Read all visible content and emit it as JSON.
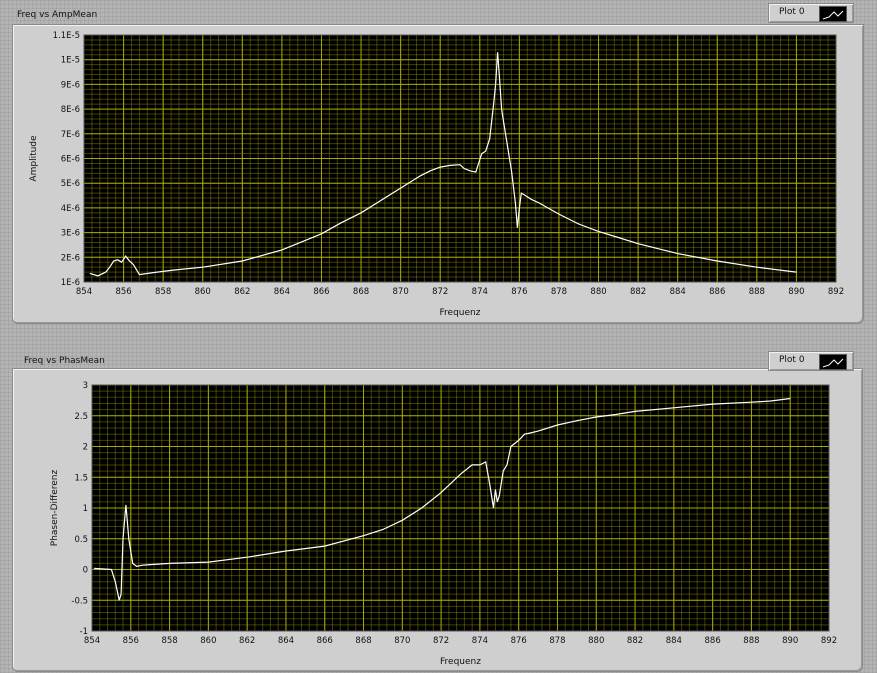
{
  "graphs": [
    {
      "title": "Freq vs AmpMean",
      "legend_label": "Plot 0"
    },
    {
      "title": "Freq vs PhasMean",
      "legend_label": "Plot 0"
    }
  ],
  "colors": {
    "plot_bg": "#000000",
    "grid": "#b4b400",
    "trace": "#ffffff"
  },
  "chart_data": [
    {
      "type": "line",
      "title": "Freq vs AmpMean",
      "xlabel": "Frequenz",
      "ylabel": "Amplitude",
      "xlim": [
        854,
        892
      ],
      "ylim": [
        1e-06,
        1.1e-05
      ],
      "x_ticks": [
        854,
        856,
        858,
        860,
        862,
        864,
        866,
        868,
        870,
        872,
        874,
        876,
        878,
        880,
        882,
        884,
        886,
        888,
        890,
        892
      ],
      "y_ticks": [
        1e-06,
        2e-06,
        3e-06,
        4e-06,
        5e-06,
        6e-06,
        7e-06,
        8e-06,
        9e-06,
        1e-05,
        1.1e-05
      ],
      "x_tick_labels": [
        "854",
        "856",
        "858",
        "860",
        "862",
        "864",
        "866",
        "868",
        "870",
        "872",
        "874",
        "876",
        "878",
        "880",
        "882",
        "884",
        "886",
        "888",
        "890",
        "892"
      ],
      "y_tick_labels": [
        "1E-6",
        "2E-6",
        "3E-6",
        "4E-6",
        "5E-6",
        "6E-6",
        "7E-6",
        "8E-6",
        "9E-6",
        "1E-5",
        "1.1E-5"
      ],
      "grid": true,
      "legend": "top-right",
      "series": [
        {
          "name": "Plot 0",
          "x": [
            854.3,
            854.7,
            855.1,
            855.3,
            855.5,
            855.7,
            855.9,
            856.1,
            856.3,
            856.5,
            856.8,
            857.5,
            858.5,
            860,
            862,
            864,
            866,
            867,
            868,
            869,
            870,
            871,
            871.5,
            872,
            872.5,
            873,
            873.2,
            873.5,
            873.8,
            874.1,
            874.3,
            874.5,
            874.7,
            874.8,
            874.9,
            875.0,
            875.1,
            875.2,
            875.4,
            875.6,
            875.8,
            875.9,
            876.0,
            876.1,
            876.3,
            876.6,
            877,
            878,
            879,
            880,
            881,
            882,
            884,
            886,
            888,
            890
          ],
          "y": [
            1.35e-06,
            1.25e-06,
            1.4e-06,
            1.6e-06,
            1.85e-06,
            1.9e-06,
            1.8e-06,
            2.05e-06,
            1.85e-06,
            1.7e-06,
            1.3e-06,
            1.38e-06,
            1.48e-06,
            1.6e-06,
            1.85e-06,
            2.3e-06,
            2.95e-06,
            3.4e-06,
            3.8e-06,
            4.3e-06,
            4.8e-06,
            5.3e-06,
            5.5e-06,
            5.65e-06,
            5.72e-06,
            5.75e-06,
            5.6e-06,
            5.5e-06,
            5.45e-06,
            6.2e-06,
            6.3e-06,
            6.8e-06,
            8.2e-06,
            9e-06,
            1.03e-05,
            9.2e-06,
            8e-06,
            7.5e-06,
            6.5e-06,
            5.5e-06,
            4.2e-06,
            3.2e-06,
            4e-06,
            4.6e-06,
            4.5e-06,
            4.35e-06,
            4.2e-06,
            3.75e-06,
            3.35e-06,
            3.05e-06,
            2.8e-06,
            2.55e-06,
            2.15e-06,
            1.85e-06,
            1.6e-06,
            1.4e-06
          ]
        }
      ]
    },
    {
      "type": "line",
      "title": "Freq vs PhasMean",
      "xlabel": "Frequenz",
      "ylabel": "Phasen-Differenz",
      "xlim": [
        854,
        892
      ],
      "ylim": [
        -1,
        3
      ],
      "x_ticks": [
        854,
        856,
        858,
        860,
        862,
        864,
        866,
        868,
        870,
        872,
        874,
        876,
        878,
        880,
        882,
        884,
        886,
        888,
        890,
        892
      ],
      "y_ticks": [
        -1,
        -0.5,
        0,
        0.5,
        1,
        1.5,
        2,
        2.5,
        3
      ],
      "x_tick_labels": [
        "854",
        "856",
        "858",
        "860",
        "862",
        "864",
        "866",
        "868",
        "870",
        "872",
        "874",
        "876",
        "878",
        "880",
        "882",
        "884",
        "886",
        "888",
        "890",
        "892"
      ],
      "y_tick_labels": [
        "-1",
        "-0.5",
        "0",
        "0.5",
        "1",
        "1.5",
        "2",
        "2.5",
        "3"
      ],
      "grid": true,
      "legend": "top-right",
      "series": [
        {
          "name": "Plot 0",
          "x": [
            854.1,
            854.5,
            855.0,
            855.2,
            855.4,
            855.5,
            855.6,
            855.75,
            855.9,
            856.1,
            856.3,
            856.6,
            857,
            858,
            860,
            862,
            864,
            866,
            868,
            869,
            870,
            871,
            872,
            873,
            873.6,
            874.0,
            874.3,
            874.5,
            874.7,
            874.8,
            874.9,
            875.0,
            875.2,
            875.4,
            875.6,
            875.8,
            876.0,
            876.3,
            876.6,
            877,
            878,
            879,
            880,
            881,
            882,
            884,
            886,
            888,
            889,
            890
          ],
          "y": [
            0.02,
            0.01,
            0.0,
            -0.2,
            -0.5,
            -0.4,
            0.5,
            1.05,
            0.5,
            0.1,
            0.05,
            0.07,
            0.08,
            0.1,
            0.12,
            0.2,
            0.3,
            0.38,
            0.55,
            0.65,
            0.8,
            1.0,
            1.25,
            1.55,
            1.7,
            1.7,
            1.75,
            1.4,
            1.0,
            1.3,
            1.1,
            1.2,
            1.6,
            1.7,
            2.0,
            2.05,
            2.1,
            2.2,
            2.22,
            2.25,
            2.35,
            2.42,
            2.48,
            2.52,
            2.57,
            2.63,
            2.69,
            2.72,
            2.74,
            2.78
          ]
        }
      ]
    }
  ]
}
